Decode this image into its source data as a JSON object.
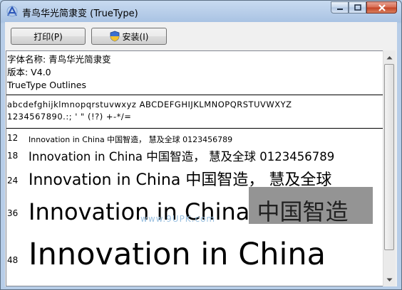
{
  "window": {
    "title": "青鸟华光简隶变 (TrueType)"
  },
  "toolbar": {
    "print_label": "打印(P)",
    "install_label": "安装(I)"
  },
  "info": {
    "font_name_line": "字体名称: 青鸟华光简隶变",
    "version_line": "版本: V4.0",
    "type_line": "TrueType Outlines"
  },
  "charset": {
    "line1": "abcdefghijklmnopqrstuvwxyz  ABCDEFGHIJKLMNOPQRSTUVWXYZ",
    "line2": "1234567890.:; ' \" (!?) +-*/="
  },
  "samples": [
    {
      "size": "12",
      "text": "Innovation in China 中国智造， 慧及全球 0123456789"
    },
    {
      "size": "18",
      "text": "Innovation in China 中国智造， 慧及全球 0123456789"
    },
    {
      "size": "24",
      "text": "Innovation in China 中国智造， 慧及全球"
    },
    {
      "size": "36",
      "text": "Innovation in China 中国智造"
    },
    {
      "size": "48",
      "text": "Innovation in China"
    }
  ],
  "watermark": "www.9UPK.com"
}
